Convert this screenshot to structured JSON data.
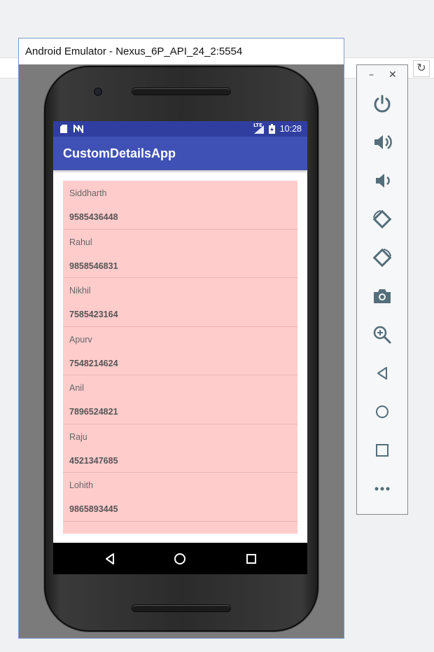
{
  "host": {
    "refresh_icon": "refresh-icon"
  },
  "emulator": {
    "title": "Android Emulator - Nexus_6P_API_24_2:5554"
  },
  "status_bar": {
    "left_icons": [
      "sd-card-icon",
      "n-notification-icon"
    ],
    "right_icons": [
      "lte-signal-icon",
      "battery-charging-icon"
    ],
    "network_label": "LTE",
    "time": "10:28"
  },
  "app": {
    "title": "CustomDetailsApp",
    "contacts": [
      {
        "name": "Siddharth",
        "phone": "9585436448"
      },
      {
        "name": "Rahul",
        "phone": "9858546831"
      },
      {
        "name": "Nikhil",
        "phone": "7585423164"
      },
      {
        "name": "Apurv",
        "phone": "7548214624"
      },
      {
        "name": "Anil",
        "phone": "7896524821"
      },
      {
        "name": "Raju",
        "phone": "4521347685"
      },
      {
        "name": "Lohith",
        "phone": "9865893445"
      }
    ]
  },
  "nav_bar": {
    "buttons": [
      "back-icon",
      "home-icon",
      "recents-icon"
    ]
  },
  "toolbar": {
    "window_controls": {
      "minimize": "–",
      "close": "✕"
    },
    "buttons": [
      "power-icon",
      "volume-up-icon",
      "volume-down-icon",
      "rotate-left-icon",
      "rotate-right-icon",
      "camera-icon",
      "zoom-icon",
      "back-icon",
      "home-icon",
      "overview-icon",
      "more-icon"
    ]
  },
  "colors": {
    "status_bar": "#303f9f",
    "app_bar": "#3f51b5",
    "list_background": "#ffcccc",
    "toolbar_icon": "#546e7a"
  }
}
